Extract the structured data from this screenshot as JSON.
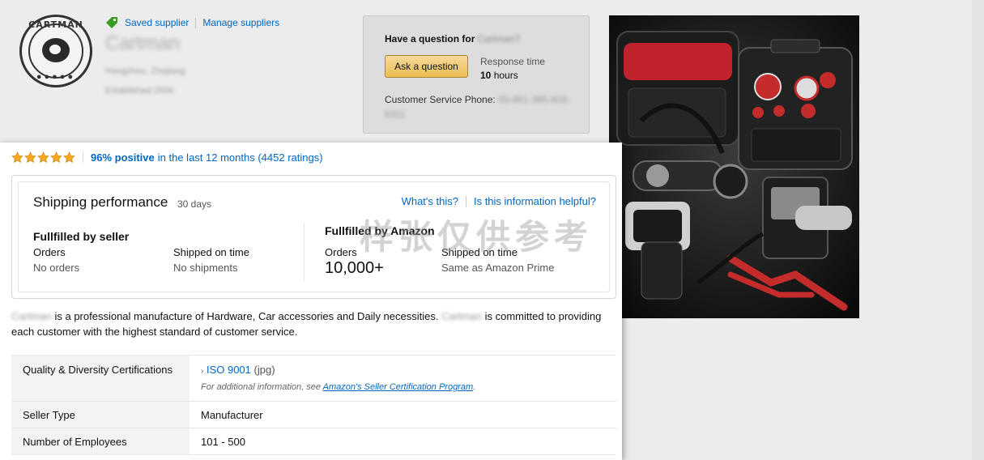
{
  "header": {
    "logo_text": "CARTMAN",
    "saved_supplier_label": "Saved supplier",
    "manage_suppliers_label": "Manage suppliers",
    "seller_name": "Cartman",
    "seller_location": "Hangzhou, Zhejiang",
    "seller_established": "Established 2006"
  },
  "question_box": {
    "title_prefix": "Have a question for",
    "title_name": "Cartman?",
    "ask_button": "Ask a question",
    "response_time_label": "Response time",
    "response_time_value": "10",
    "response_time_unit": "hours",
    "phone_label": "Customer Service Phone:",
    "phone_value": "00-861-385-818-6311"
  },
  "rating": {
    "stars": 5,
    "percent": "96% positive",
    "rest": "in the last 12 months (4452 ratings)"
  },
  "shipping": {
    "title": "Shipping performance",
    "days": "30 days",
    "whats_this": "What's this?",
    "helpful": "Is this information helpful?",
    "seller": {
      "heading": "Fullfilled by seller",
      "orders_label": "Orders",
      "orders_value": "No orders",
      "ontime_label": "Shipped on time",
      "ontime_value": "No shipments"
    },
    "amazon": {
      "heading": "Fullfilled by Amazon",
      "orders_label": "Orders",
      "orders_value": "10,000+",
      "ontime_label": "Shipped on time",
      "ontime_value": "Same as Amazon Prime"
    }
  },
  "description": {
    "name1": "Cartman",
    "part1": "is a professional manufacture of Hardware, Car accessories and Daily necessities.",
    "name2": "Cartman",
    "part2": "is committed to providing each customer with the highest standard of customer service."
  },
  "details": {
    "cert_label": "Quality & Diversity Certifications",
    "cert_link": "ISO 9001",
    "cert_type": "(jpg)",
    "cert_note_prefix": "For additional information, see",
    "cert_note_link": "Amazon's Seller Certification Program",
    "seller_type_label": "Seller Type",
    "seller_type_value": "Manufacturer",
    "employees_label": "Number of Employees",
    "employees_value": "101 - 500"
  },
  "watermark": "样张仅供参考",
  "colors": {
    "link": "#0066c0",
    "star": "#f5a623",
    "tag": "#3a9d23",
    "button": "#f0c14b"
  }
}
